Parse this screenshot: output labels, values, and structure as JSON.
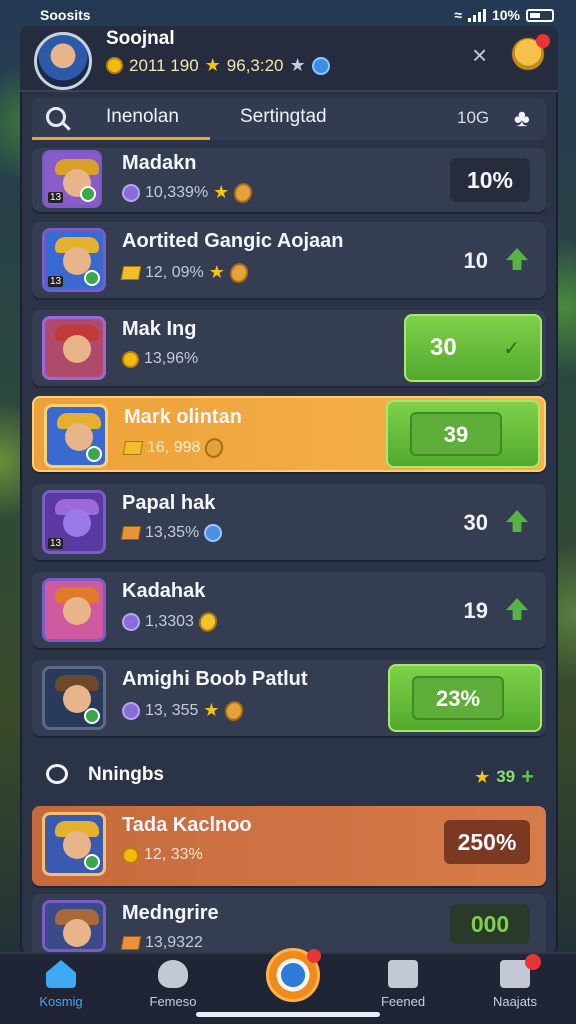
{
  "status_bar": {
    "app": "Soosits",
    "battery": "10%"
  },
  "header": {
    "name": "Soojnal",
    "coins": "2011 190",
    "stars": "96,3:20"
  },
  "tabs": [
    {
      "label": "Inenolan"
    },
    {
      "label": "Sertingtad"
    }
  ],
  "tabs_count": "10G",
  "rows": [
    {
      "name": "Madakn",
      "sub": "10,339%",
      "value": "10%",
      "lvl": "13"
    },
    {
      "name": "Aortited Gangic Aojaan",
      "sub": "12, 09%",
      "value": "10",
      "lvl": "13"
    },
    {
      "name": "Mak Ing",
      "sub": "13,96%",
      "value": "30"
    },
    {
      "name": "Mark olintan",
      "sub": "16, 998",
      "value": "39"
    },
    {
      "name": "Papal hak",
      "sub": "13,35%",
      "value": "30",
      "lvl": "13"
    },
    {
      "name": "Kadahak",
      "sub": "1,3303",
      "value": "19"
    },
    {
      "name": "Amighi Boob Patlut",
      "sub": "13, 355",
      "value": "23%"
    }
  ],
  "section": {
    "title": "Nningbs",
    "stat": "39"
  },
  "rows2": [
    {
      "name": "Tada Kaclnoo",
      "sub": "12, 33%",
      "value": "250%"
    },
    {
      "name": "Medngrire",
      "sub": "13,9322",
      "value": "000"
    }
  ],
  "nav": [
    {
      "label": "Kosmig"
    },
    {
      "label": "Femeso"
    },
    {
      "label": "Feened"
    },
    {
      "label": "Naajats"
    }
  ],
  "colors": {
    "accent_orange": "#f0a13b",
    "green": "#56b445",
    "panel": "#2b3347"
  }
}
